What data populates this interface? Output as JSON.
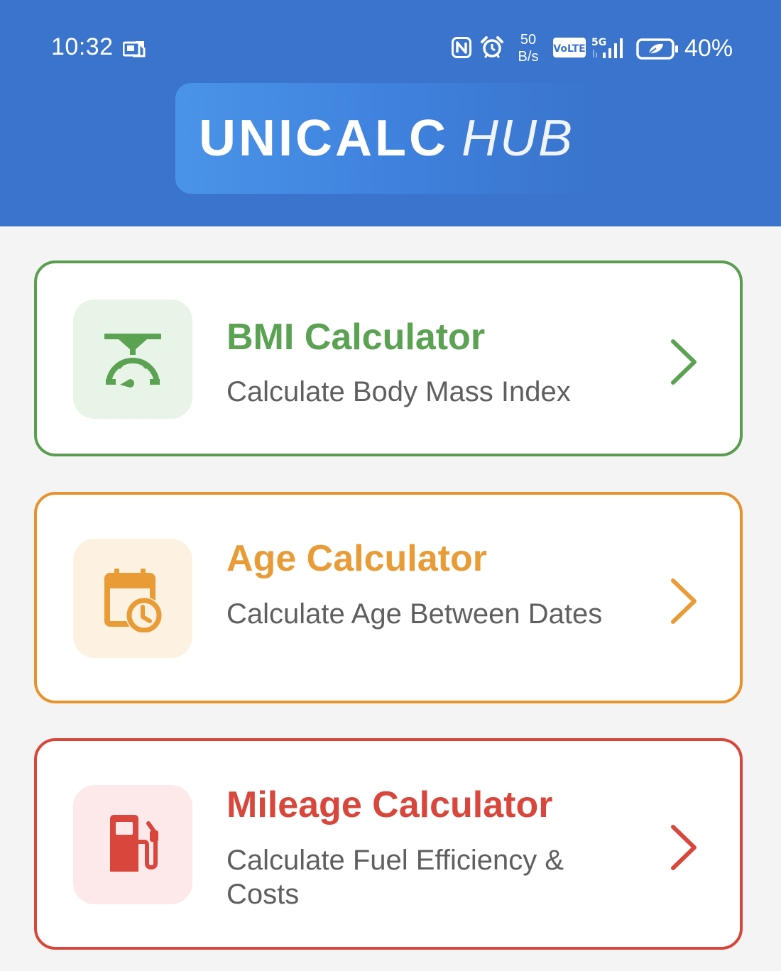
{
  "status_bar": {
    "time": "10:32",
    "net_speed_value": "50",
    "net_speed_unit": "B/s",
    "battery_percent": "40%",
    "volte_label": "VoLTE",
    "network_label": "5G"
  },
  "header": {
    "title_bold": "UNICALC",
    "title_light": "HUB"
  },
  "cards": [
    {
      "title": "BMI Calculator",
      "subtitle": "Calculate Body Mass Index",
      "icon": "scale-icon",
      "accent": "#5ba253"
    },
    {
      "title": "Age Calculator",
      "subtitle": "Calculate Age Between Dates",
      "icon": "calendar-clock-icon",
      "accent": "#e99b35"
    },
    {
      "title": "Mileage Calculator",
      "subtitle": "Calculate Fuel Efficiency & Costs",
      "icon": "fuel-pump-icon",
      "accent": "#d9473c"
    }
  ],
  "colors": {
    "header_bg": "#3a74cc",
    "page_bg": "#f4f4f4"
  }
}
